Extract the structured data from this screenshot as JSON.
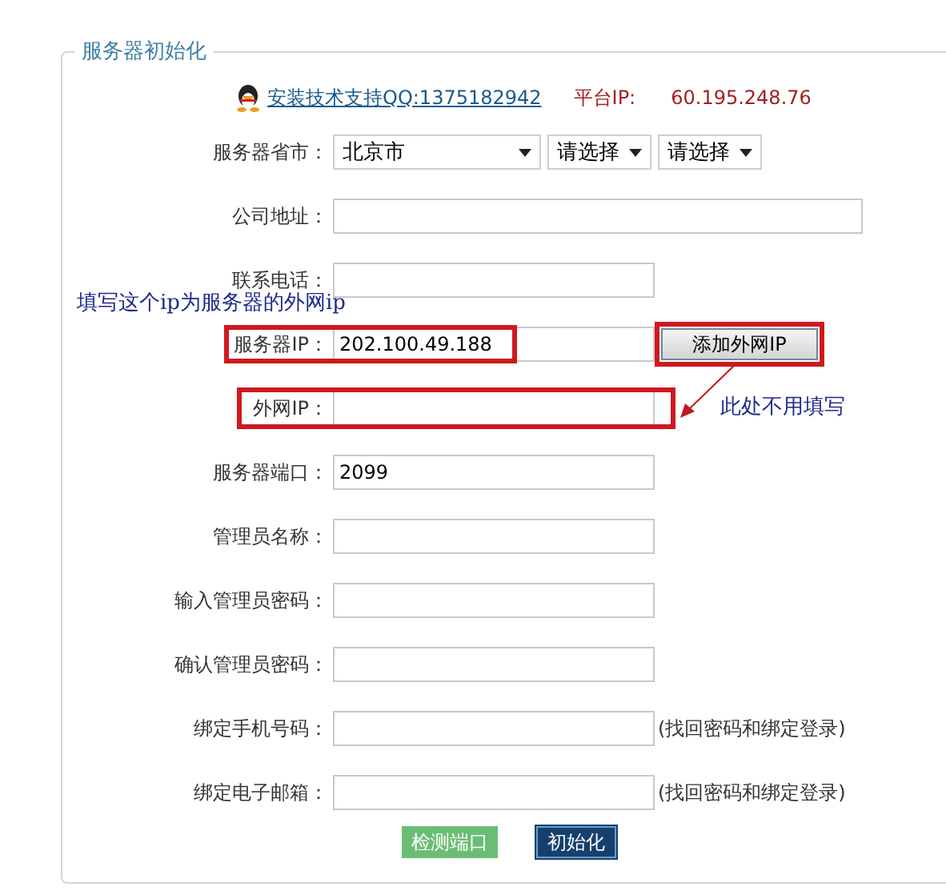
{
  "legend": "服务器初始化",
  "support": {
    "link": "安装技术支持QQ:1375182942",
    "platform_label": "平台IP:",
    "platform_ip": "60.195.248.76"
  },
  "region": {
    "label": "服务器省市：",
    "selects": [
      "北京市",
      "请选择",
      "请选择"
    ]
  },
  "fields": [
    {
      "label": "公司地址：",
      "kind": "wide",
      "highlighted": false
    },
    {
      "label": "联系电话：",
      "kind": "normal",
      "highlighted": false
    },
    {
      "label": "服务器IP：",
      "kind": "normal",
      "value": "202.100.49.188",
      "highlighted": true,
      "annotation_above": "填写这个ip为服务器的外网ip",
      "button": {
        "label": "添加外网IP",
        "highlighted": true
      }
    },
    {
      "label": "外网IP：",
      "kind": "normal",
      "highlighted": true,
      "callout": "此处不用填写"
    },
    {
      "label": "服务器端口：",
      "kind": "normal",
      "value": "2099",
      "highlighted": false
    },
    {
      "label": "管理员名称：",
      "kind": "normal",
      "highlighted": false
    },
    {
      "label": "输入管理员密码：",
      "kind": "normal",
      "highlighted": false
    },
    {
      "label": "确认管理员密码：",
      "kind": "normal",
      "highlighted": false
    },
    {
      "label": "绑定手机号码：",
      "kind": "normal",
      "highlighted": false,
      "note": "(找回密码和绑定登录)"
    },
    {
      "label": "绑定电子邮箱：",
      "kind": "normal",
      "highlighted": false,
      "note": "(找回密码和绑定登录)"
    }
  ],
  "actions": [
    {
      "label": "检测端口",
      "kind": "secondary"
    },
    {
      "label": "初始化",
      "kind": "primary"
    }
  ]
}
